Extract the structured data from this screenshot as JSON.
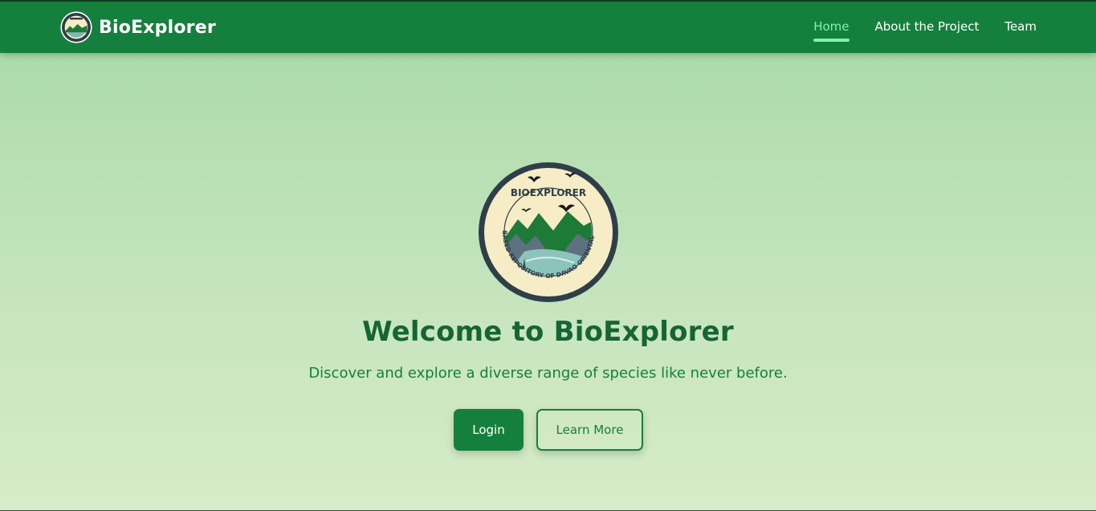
{
  "navbar": {
    "brand_name": "BioExplorer",
    "links": [
      {
        "label": "Home",
        "active": true
      },
      {
        "label": "About the Project",
        "active": false
      },
      {
        "label": "Team",
        "active": false
      }
    ]
  },
  "hero": {
    "logo": {
      "title": "BIOEXPLORER",
      "ring_text": "\"A WEB-BASED REPOSITORY OF DAVAO ORIENTAL SPECIES\""
    },
    "title": "Welcome to BioExplorer",
    "subtitle": "Discover and explore a diverse range of species like never before.",
    "login_label": "Login",
    "learn_more_label": "Learn More"
  },
  "colors": {
    "primary": "#15803d",
    "active_link": "#86efac",
    "title_text": "#166534",
    "background_top": "#a6d9a5",
    "background_bottom": "#d7ebc8"
  }
}
